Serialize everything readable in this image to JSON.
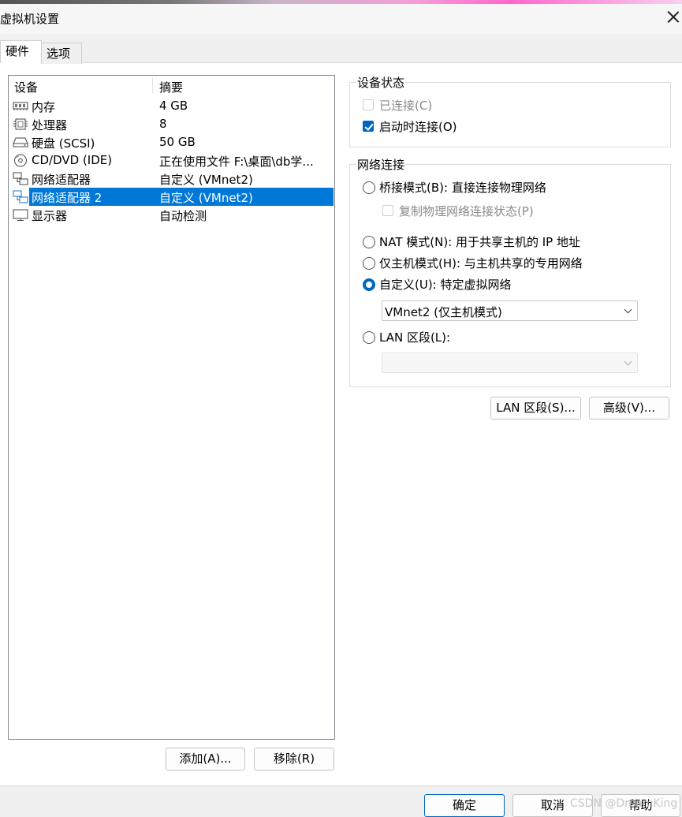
{
  "window": {
    "title": "虚拟机设置",
    "close_icon": "close-icon"
  },
  "tabs": [
    {
      "label": "硬件",
      "active": true
    },
    {
      "label": "选项",
      "active": false
    }
  ],
  "device_list": {
    "headers": {
      "device": "设备",
      "summary": "摘要"
    },
    "rows": [
      {
        "icon": "memory-icon",
        "name": "内存",
        "summary": "4 GB",
        "selected": false
      },
      {
        "icon": "processor-icon",
        "name": "处理器",
        "summary": "8",
        "selected": false
      },
      {
        "icon": "hard-disk-icon",
        "name": "硬盘 (SCSI)",
        "summary": "50 GB",
        "selected": false
      },
      {
        "icon": "cd-dvd-icon",
        "name": "CD/DVD (IDE)",
        "summary": "正在使用文件 F:\\桌面\\db学...",
        "selected": false
      },
      {
        "icon": "network-adapter-icon",
        "name": "网络适配器",
        "summary": "自定义 (VMnet2)",
        "selected": false
      },
      {
        "icon": "network-adapter-icon",
        "name": "网络适配器 2",
        "summary": "自定义 (VMnet2)",
        "selected": true
      },
      {
        "icon": "display-icon",
        "name": "显示器",
        "summary": "自动检测",
        "selected": false
      }
    ],
    "add_button": "添加(A)...",
    "remove_button": "移除(R)"
  },
  "device_status": {
    "title": "设备状态",
    "connected": {
      "label": "已连接(C)",
      "checked": false,
      "disabled": true
    },
    "connect_at_power_on": {
      "label": "启动时连接(O)",
      "checked": true
    }
  },
  "network_connection": {
    "title": "网络连接",
    "bridged": {
      "label": "桥接模式(B): 直接连接物理网络",
      "selected": false
    },
    "replicate_state": {
      "label": "复制物理网络连接状态(P)",
      "checked": false,
      "disabled": true
    },
    "nat": {
      "label": "NAT 模式(N): 用于共享主机的 IP 地址",
      "selected": false
    },
    "host_only": {
      "label": "仅主机模式(H): 与主机共享的专用网络",
      "selected": false
    },
    "custom": {
      "label": "自定义(U): 特定虚拟网络",
      "selected": true
    },
    "custom_select_value": "VMnet2 (仅主机模式)",
    "lan_segment": {
      "label": "LAN 区段(L):",
      "selected": false
    },
    "lan_select_value": ""
  },
  "right_buttons": {
    "lan_segments": "LAN 区段(S)...",
    "advanced": "高级(V)..."
  },
  "footer": {
    "ok": "确定",
    "cancel": "取消",
    "help": "帮助"
  },
  "watermark": "CSDN @DreamKing"
}
